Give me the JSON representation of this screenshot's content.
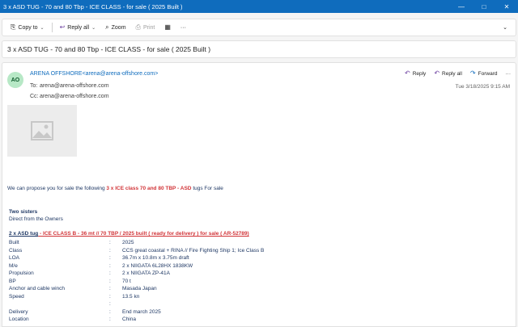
{
  "window": {
    "title": "3 x ASD TUG - 70 and 80 Tbp - ICE CLASS - for sale ( 2025 Built )",
    "controls": [
      "—",
      "□",
      "✕"
    ]
  },
  "toolbar": {
    "copy_to": "Copy to",
    "reply_all": "Reply all",
    "zoom": "Zoom",
    "print": "Print",
    "more": "···",
    "collapse": "⌄"
  },
  "subject": "3 x ASD TUG - 70 and 80 Tbp - ICE CLASS - for sale ( 2025 Built )",
  "message": {
    "avatar_initials": "AO",
    "sender": "ARENA OFFSHORE<arena@arena-offshore.com>",
    "to_label": "To:",
    "to": "arena@arena-offshore.com",
    "cc_label": "Cc:",
    "cc": "arena@arena-offshore.com",
    "actions": {
      "reply": "Reply",
      "reply_all": "Reply all",
      "forward": "Forward",
      "more": "···"
    },
    "date": "Tue 3/18/2025 9:15 AM"
  },
  "body": {
    "intro_before": "We can propose you for sale the following ",
    "intro_highlight": "3 x ICE class 70 and 80 TBP - ASD",
    "intro_after": " tugs For sale",
    "group_title": "Two sisters",
    "group_sub": "Direct from the Owners",
    "item_heading_prefix": "2 x ASD tug",
    "item_heading_red": " - ICE CLASS B - 36 mt // 70 TBP / 2025 built ( ready for delivery ) for sale ( AR-52789)",
    "specs": [
      {
        "key": "Built",
        "sep": ":",
        "value": "2025"
      },
      {
        "key": "Class",
        "sep": ":",
        "value": "CCS great coastal   + RINA // Fire Fighting Ship 1; Ice Class B"
      },
      {
        "key": "LOA",
        "sep": ":",
        "value": "36.7m x 10.8m x 3.75m draft"
      },
      {
        "key": "M/e",
        "sep": ":",
        "value": "2 x NIIGATA 6L28HX  1838KW"
      },
      {
        "key": "Propulsion",
        "sep": ":",
        "value": "2 x NIIGATA ZP-41A"
      },
      {
        "key": "BP",
        "sep": ":",
        "value": "70 t"
      },
      {
        "key": "Anchor and cable winch",
        "sep": ":",
        "value": "Masada Japan"
      },
      {
        "key": "Speed",
        "sep": ":",
        "value": "13.5 kn"
      },
      {
        "key": "",
        "sep": ":",
        "value": ""
      },
      {
        "key": "Delivery",
        "sep": ":",
        "value": "End march 2025"
      },
      {
        "key": "Location",
        "sep": ":",
        "value": "China"
      }
    ]
  }
}
